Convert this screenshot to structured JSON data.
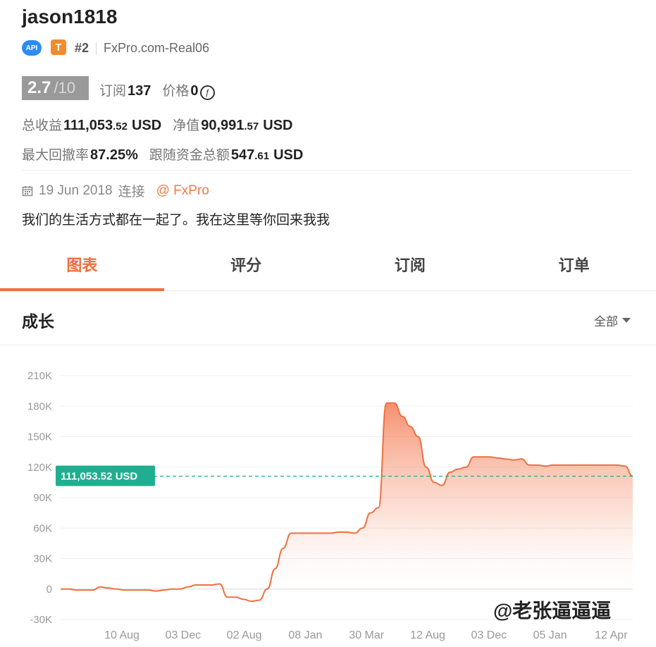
{
  "profile": {
    "username": "jason1818",
    "api_badge": "API",
    "type_badge": "T",
    "rank": "#2",
    "server": "FxPro.com-Real06"
  },
  "rating": {
    "score": "2.7",
    "max": "/10"
  },
  "stats": {
    "subscribers_label": "订阅",
    "subscribers_value": "137",
    "price_label": "价格",
    "price_value": "0",
    "price_icon": "ƒ",
    "total_profit_label": "总收益",
    "total_profit_int": "111,053",
    "total_profit_dec": ".52",
    "total_profit_unit": "USD",
    "equity_label": "净值",
    "equity_int": "90,991",
    "equity_dec": ".57",
    "equity_unit": "USD",
    "max_dd_label": "最大回撤率",
    "max_dd_value": "87.25%",
    "follow_funds_label": "跟随资金总额",
    "follow_funds_int": "547",
    "follow_funds_dec": ".61",
    "follow_funds_unit": "USD"
  },
  "connection": {
    "icon": "calendar-icon",
    "date": "19 Jun 2018",
    "connected_label": "连接",
    "broker": "@ FxPro"
  },
  "description": "我们的生活方式都在一起了。我在这里等你回来我我",
  "tabs": [
    {
      "label": "图表",
      "active": true
    },
    {
      "label": "评分",
      "active": false
    },
    {
      "label": "订阅",
      "active": false
    },
    {
      "label": "订单",
      "active": false
    }
  ],
  "section": {
    "title": "成长",
    "filter": "全部"
  },
  "colors": {
    "accent": "#ef6d3f",
    "marker": "#1fae8f",
    "rating_bg": "#9a9a9a"
  },
  "chart_data": {
    "type": "area",
    "yticks": [
      "210K",
      "180K",
      "150K",
      "120K",
      "90K",
      "60K",
      "30K",
      "0",
      "-30K"
    ],
    "ylim": [
      -30000,
      210000
    ],
    "xticks": [
      "10 Aug",
      "03 Dec",
      "02 Aug",
      "08 Jan",
      "30 Mar",
      "12 Aug",
      "03 Dec",
      "05 Jan",
      "12 Apr"
    ],
    "current_label": "111,053.52 USD",
    "current_value": 111053.52,
    "series": [
      {
        "values": [
          0,
          0,
          -1000,
          -1000,
          -1000,
          2000,
          1000,
          0,
          -1000,
          -1000,
          -1000,
          -1000,
          -2000,
          -1000,
          0,
          0,
          2000,
          4000,
          4000,
          4000,
          5000,
          -8000,
          -8000,
          -10000,
          -12000,
          -11000,
          0,
          20000,
          40000,
          55000,
          55000,
          55000,
          55000,
          55000,
          55000,
          56000,
          56000,
          55000,
          60000,
          75000,
          80000,
          183000,
          183000,
          170000,
          160000,
          150000,
          120000,
          105000,
          102000,
          115000,
          118000,
          120000,
          130000,
          130000,
          130000,
          129000,
          128000,
          127000,
          128000,
          122000,
          122000,
          121000,
          122000,
          122000,
          122000,
          122000,
          122000,
          122000,
          122000,
          122000,
          122000,
          121000,
          111053.52
        ]
      }
    ]
  },
  "watermark": "@老张逼逼逼"
}
